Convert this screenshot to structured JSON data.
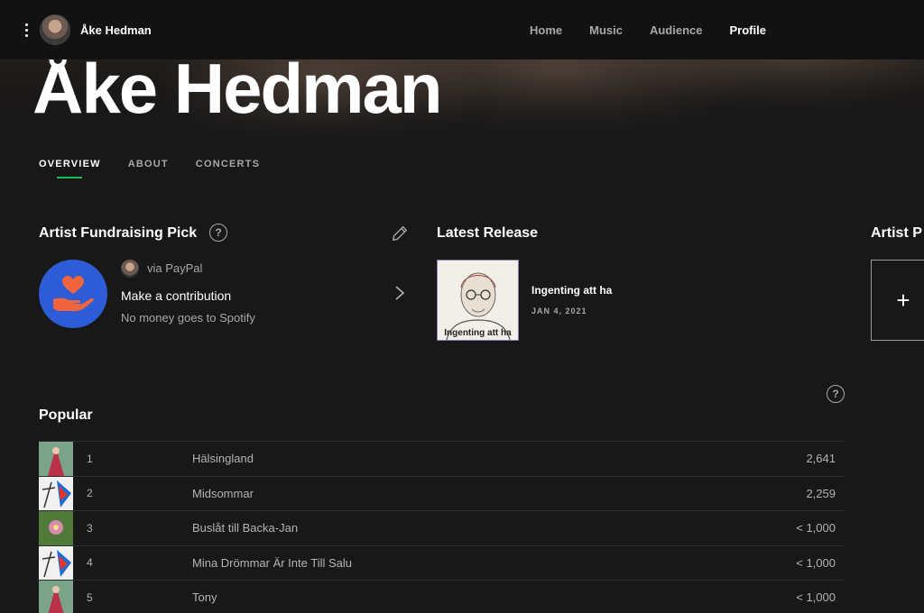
{
  "artist": {
    "name": "Åke Hedman"
  },
  "nav": {
    "items": [
      "Home",
      "Music",
      "Audience",
      "Profile"
    ],
    "active": "Profile"
  },
  "tabs": {
    "items": [
      "OVERVIEW",
      "ABOUT",
      "CONCERTS"
    ],
    "active": "OVERVIEW"
  },
  "fundraising": {
    "heading": "Artist Fundraising Pick",
    "help": "?",
    "via": "via PayPal",
    "title": "Make a contribution",
    "subtitle": "No money goes to Spotify"
  },
  "latest": {
    "heading": "Latest Release",
    "cover_text": "Ingenting att ha",
    "title": "Ingenting att ha",
    "date": "JAN 4, 2021"
  },
  "pick": {
    "heading": "Artist P",
    "add": "+"
  },
  "popular": {
    "heading": "Popular",
    "help": "?",
    "rows": [
      {
        "rank": "1",
        "song": "Hälsingland",
        "streams": "2,641"
      },
      {
        "rank": "2",
        "song": "Midsommar",
        "streams": "2,259"
      },
      {
        "rank": "3",
        "song": "Buslåt till Backa-Jan",
        "streams": "< 1,000"
      },
      {
        "rank": "4",
        "song": "Mina Drömmar Är Inte Till Salu",
        "streams": "< 1,000"
      },
      {
        "rank": "5",
        "song": "Tony",
        "streams": "< 1,000"
      }
    ]
  },
  "colors": {
    "accent": "#1db954",
    "background": "#181818",
    "topbar": "#121212",
    "fund_logo": "#2e5bd6",
    "heart": "#f0653d"
  }
}
